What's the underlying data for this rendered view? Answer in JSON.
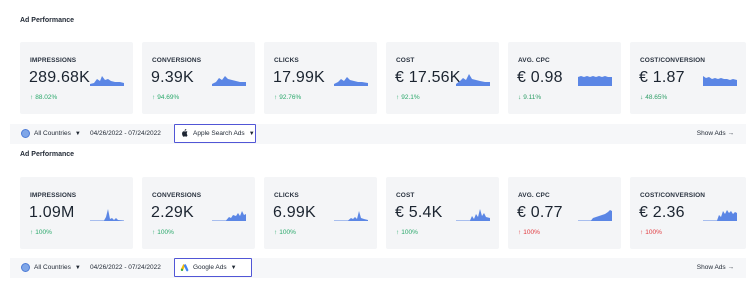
{
  "sections": [
    {
      "title": "Ad Performance",
      "cards": [
        {
          "label": "IMPRESSIONS",
          "value": "289.68K",
          "change": "88.02%",
          "dir": "up"
        },
        {
          "label": "CONVERSIONS",
          "value": "9.39K",
          "change": "94.69%",
          "dir": "up"
        },
        {
          "label": "CLICKS",
          "value": "17.99K",
          "change": "92.76%",
          "dir": "up"
        },
        {
          "label": "COST",
          "value": "€ 17.56K",
          "change": "92.1%",
          "dir": "up"
        },
        {
          "label": "AVG. CPC",
          "value": "€ 0.98",
          "change": "9.11%",
          "dir": "down"
        },
        {
          "label": "COST/CONVERSION",
          "value": "€ 1.87",
          "change": "48.65%",
          "dir": "down"
        }
      ],
      "toolbar": {
        "countries": "All Countries",
        "date_range": "04/26/2022 - 07/24/2022",
        "platform": "Apple Search Ads",
        "platform_icon": "apple-icon",
        "show_ads": "Show Ads"
      }
    },
    {
      "title": "Ad Performance",
      "cards": [
        {
          "label": "IMPRESSIONS",
          "value": "1.09M",
          "change": "100%",
          "dir": "up"
        },
        {
          "label": "CONVERSIONS",
          "value": "2.29K",
          "change": "100%",
          "dir": "up"
        },
        {
          "label": "CLICKS",
          "value": "6.99K",
          "change": "100%",
          "dir": "up"
        },
        {
          "label": "COST",
          "value": "€ 5.4K",
          "change": "100%",
          "dir": "up"
        },
        {
          "label": "AVG. CPC",
          "value": "€ 0.77",
          "change": "100%",
          "dir": "up-red"
        },
        {
          "label": "COST/CONVERSION",
          "value": "€ 2.36",
          "change": "100%",
          "dir": "up-red"
        }
      ],
      "toolbar": {
        "countries": "All Countries",
        "date_range": "04/26/2022 - 07/24/2022",
        "platform": "Google Ads",
        "platform_icon": "google-ads-icon",
        "show_ads": "Show Ads"
      }
    }
  ],
  "colors": {
    "accent": "#5156d6",
    "sparkline": "#5b86e5",
    "positive": "#29a86a",
    "negative": "#e0393e"
  }
}
